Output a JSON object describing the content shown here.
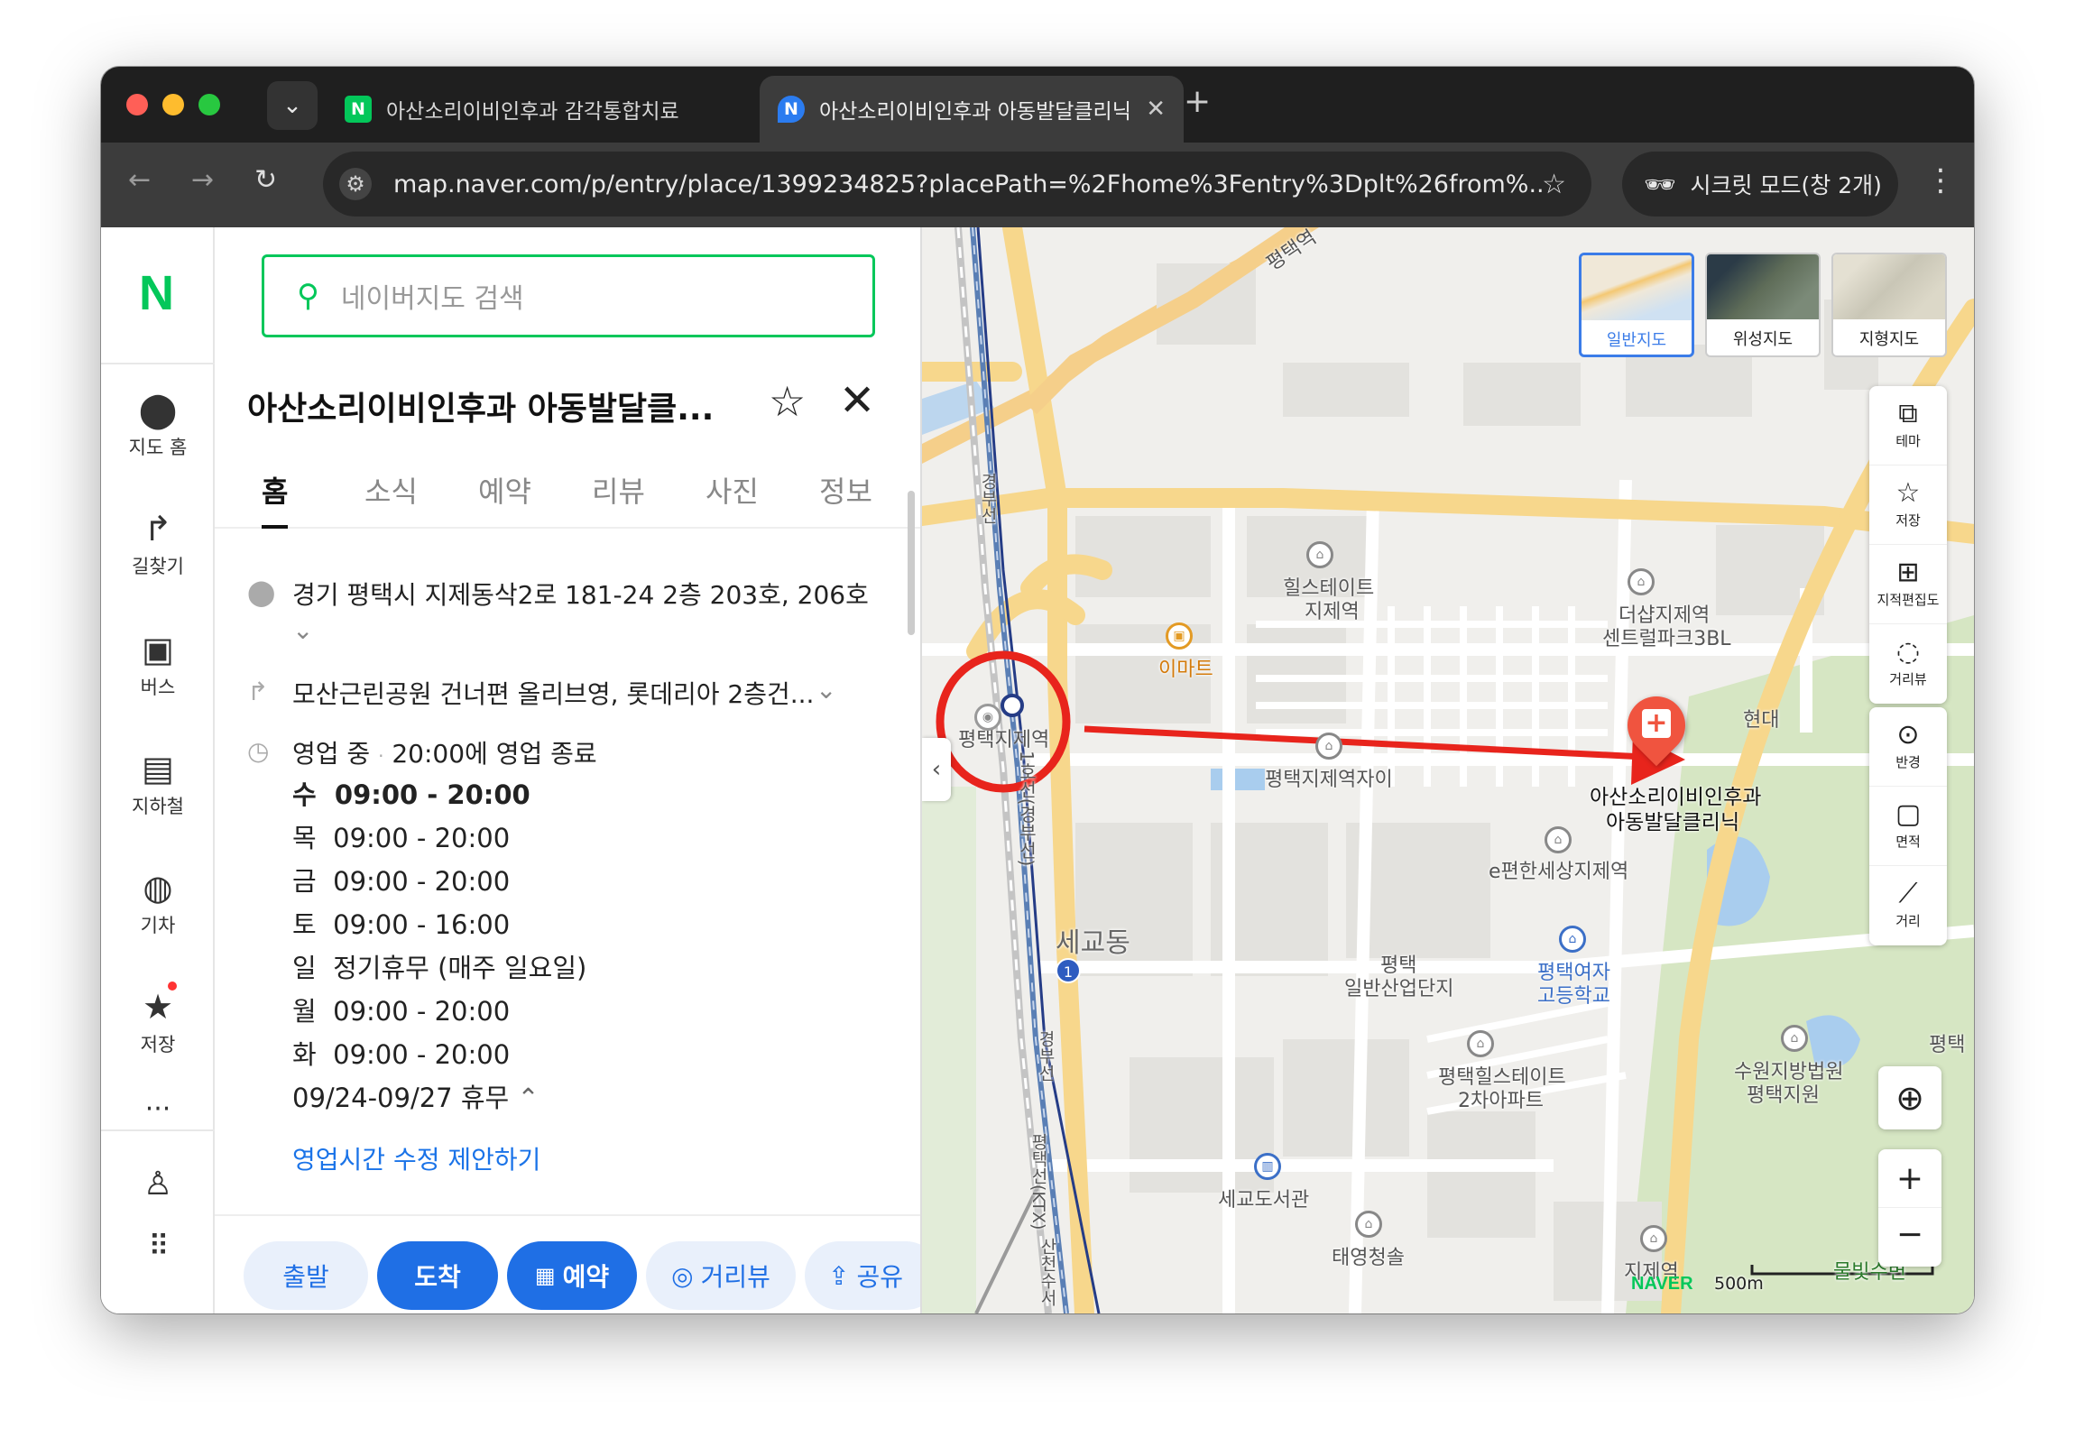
{
  "browser": {
    "tabs": [
      {
        "title": "아산소리이비인후과 감각통합치료",
        "favicon": "N",
        "favicon_color": "#03c75a"
      },
      {
        "title": "아산소리이비인후과 아동발달클리닉",
        "favicon": "N",
        "favicon_color": "#2b7cf0"
      }
    ],
    "url": "map.naver.com/p/entry/place/1399234825?placePath=%2Fhome%3Fentry%3Dplt%26from%...",
    "incognito_label": "시크릿 모드(창 2개)"
  },
  "rail": {
    "items": [
      {
        "label": "지도 홈",
        "icon": "map-pin-icon"
      },
      {
        "label": "길찾기",
        "icon": "directions-icon"
      },
      {
        "label": "버스",
        "icon": "bus-icon"
      },
      {
        "label": "지하철",
        "icon": "subway-icon"
      },
      {
        "label": "기차",
        "icon": "train-icon"
      },
      {
        "label": "저장",
        "icon": "star-icon"
      }
    ],
    "more": "···"
  },
  "search": {
    "placeholder": "네이버지도 검색"
  },
  "place": {
    "title": "아산소리이비인후과 아동발달클...",
    "tabs": [
      "홈",
      "소식",
      "예약",
      "리뷰",
      "사진",
      "정보"
    ],
    "address": "경기 평택시 지제동삭2로 181-24 2층 203호, 206호",
    "directions": "모산근린공원 건너편 올리브영, 롯데리아 2층건...",
    "status": "영업 중",
    "status_sep": "·",
    "status_detail": "20:00에 영업 종료",
    "hours": [
      {
        "day": "수",
        "time": "09:00 - 20:00",
        "bold": true
      },
      {
        "day": "목",
        "time": "09:00 - 20:00"
      },
      {
        "day": "금",
        "time": "09:00 - 20:00"
      },
      {
        "day": "토",
        "time": "09:00 - 16:00"
      },
      {
        "day": "일",
        "time": "정기휴무 (매주 일요일)"
      },
      {
        "day": "월",
        "time": "09:00 - 20:00"
      },
      {
        "day": "화",
        "time": "09:00 - 20:00"
      }
    ],
    "holiday": "09/24-09/27 휴무",
    "suggest_link": "영업시간 수정 제안하기"
  },
  "actions": {
    "depart": "출발",
    "arrive": "도착",
    "reserve": "예약",
    "roadview": "거리뷰",
    "share": "공유"
  },
  "map": {
    "types": [
      "일반지도",
      "위성지도",
      "지형지도"
    ],
    "tools": [
      "테마",
      "저장",
      "지적편집도",
      "거리뷰"
    ],
    "tools2": [
      "반경",
      "면적",
      "거리"
    ],
    "labels": {
      "station": "평택지제역",
      "line1": "1호선(경부선)",
      "gyeongbu": "경부선",
      "gyeongbu2": "경부선",
      "ktx": "평택선(KTX)",
      "sanchon": "산천수서",
      "pyeongtaek_top": "평택역",
      "hillstate": "힐스테이트",
      "hillstate2": "지제역",
      "emart": "이마트",
      "thesharp": "더샵지제역",
      "thesharp2": "센트럴파크3BL",
      "hyundai": "현대",
      "jije_xi": "평택지제역자이",
      "clinic1": "아산소리이비인후과",
      "clinic2": "아동발달클리닉",
      "epyunhan": "e편한세상지제역",
      "segyo": "세교동",
      "industrial1": "평택",
      "industrial2": "일반산업단지",
      "girls1": "평택여자",
      "girls2": "고등학교",
      "hill2a": "평택힐스테이트",
      "hill2b": "2차아파트",
      "court1": "수원지방법원",
      "court2": "평택지원",
      "library": "세교도서관",
      "youth": "태영청솔",
      "jije_bottom": "지제역",
      "mulbit": "물빛수변",
      "pyeongtaek_r": "평택",
      "scale": "500m",
      "naver": "NAVER",
      "line_badge": "1"
    }
  }
}
